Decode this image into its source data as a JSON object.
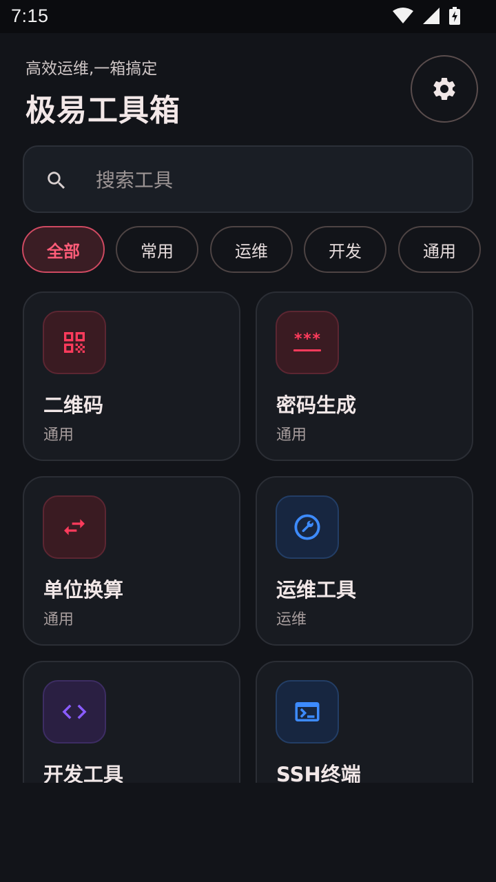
{
  "status_bar": {
    "time": "7:15"
  },
  "header": {
    "subtitle": "高效运维,一箱搞定",
    "title": "极易工具箱"
  },
  "search": {
    "placeholder": "搜索工具",
    "value": ""
  },
  "chips": [
    {
      "label": "全部",
      "active": true
    },
    {
      "label": "常用",
      "active": false
    },
    {
      "label": "运维",
      "active": false
    },
    {
      "label": "开发",
      "active": false
    },
    {
      "label": "通用",
      "active": false
    }
  ],
  "tools": [
    {
      "name": "二维码",
      "category": "通用",
      "icon": "qr-code-icon",
      "color": "#ff3b5c"
    },
    {
      "name": "密码生成",
      "category": "通用",
      "icon": "password-icon",
      "color": "#ff3b5c"
    },
    {
      "name": "单位换算",
      "category": "通用",
      "icon": "swap-arrows-icon",
      "color": "#ff3b5c"
    },
    {
      "name": "运维工具",
      "category": "运维",
      "icon": "wrench-icon",
      "color": "#3d8bff"
    },
    {
      "name": "开发工具",
      "category": "",
      "icon": "code-icon",
      "color": "#8a5cff"
    },
    {
      "name": "SSH终端",
      "category": "",
      "icon": "terminal-icon",
      "color": "#3d8bff"
    }
  ],
  "colors": {
    "accent": "#ff3b5c",
    "background": "#121419",
    "card": "#181b21"
  }
}
